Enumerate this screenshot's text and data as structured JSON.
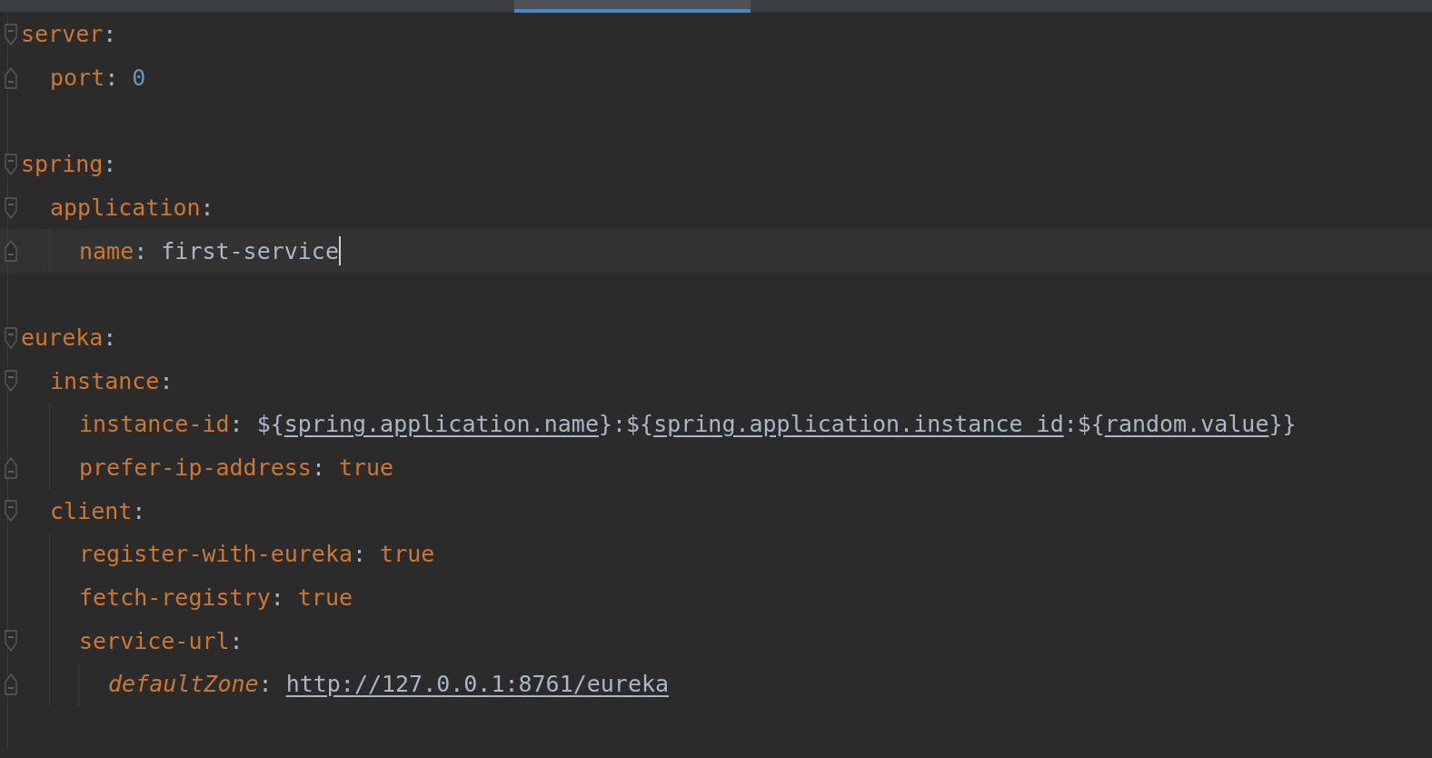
{
  "tabs": [
    {
      "selected": true
    }
  ],
  "document": [
    {
      "key": "server",
      "sep": ":",
      "blank_after": true,
      "children": [
        {
          "key": "port",
          "sep": ":",
          "value": [
            {
              "kind": "number",
              "text": "0"
            }
          ]
        }
      ]
    },
    {
      "key": "spring",
      "sep": ":",
      "blank_after": true,
      "children": [
        {
          "key": "application",
          "sep": ":",
          "children": [
            {
              "key": "name",
              "sep": ":",
              "current": true,
              "value": [
                {
                  "kind": "text",
                  "text": "first-service"
                }
              ]
            }
          ]
        }
      ]
    },
    {
      "key": "eureka",
      "sep": ":",
      "blank_after": true,
      "children": [
        {
          "key": "instance",
          "sep": ":",
          "children": [
            {
              "key": "instance-id",
              "sep": ":",
              "value": [
                {
                  "kind": "text",
                  "text": "${"
                },
                {
                  "kind": "ref",
                  "text": "spring.application.name"
                },
                {
                  "kind": "text",
                  "text": "}:${"
                },
                {
                  "kind": "ref",
                  "text": "spring.application.instance_id"
                },
                {
                  "kind": "text",
                  "text": ":${"
                },
                {
                  "kind": "ref",
                  "text": "random.value"
                },
                {
                  "kind": "text",
                  "text": "}}"
                }
              ]
            },
            {
              "key": "prefer-ip-address",
              "sep": ":",
              "value": [
                {
                  "kind": "bool",
                  "text": "true"
                }
              ]
            }
          ]
        },
        {
          "key": "client",
          "sep": ":",
          "children": [
            {
              "key": "register-with-eureka",
              "sep": ":",
              "value": [
                {
                  "kind": "bool",
                  "text": "true"
                }
              ]
            },
            {
              "key": "fetch-registry",
              "sep": ":",
              "value": [
                {
                  "kind": "bool",
                  "text": "true"
                }
              ]
            },
            {
              "key": "service-url",
              "sep": ":",
              "children": [
                {
                  "key": "defaultZone",
                  "sep": ":",
                  "italic": true,
                  "value": [
                    {
                      "kind": "link",
                      "text": "http://127.0.0.1:8761/eureka"
                    }
                  ]
                }
              ]
            }
          ]
        }
      ]
    }
  ]
}
